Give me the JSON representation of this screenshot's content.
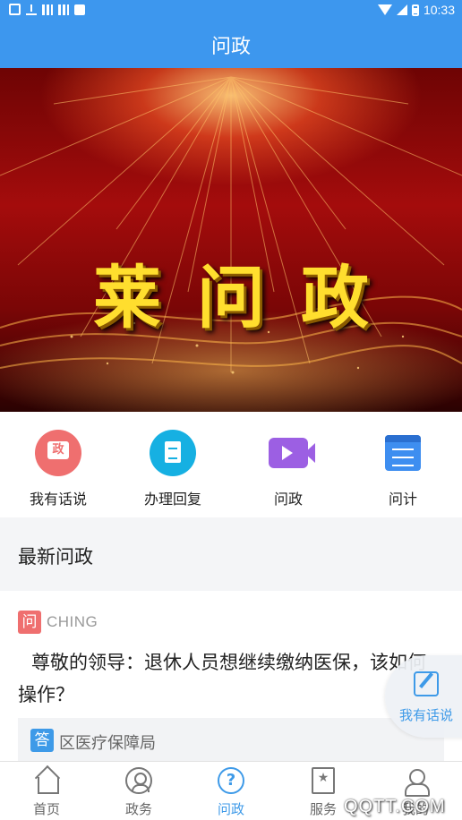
{
  "status_bar": {
    "time": "10:33"
  },
  "app_bar": {
    "title": "问政"
  },
  "banner": {
    "title": "莱问政"
  },
  "quick_menu": [
    {
      "label": "我有话说",
      "icon": "speech-bubble-icon"
    },
    {
      "label": "办理回复",
      "icon": "document-icon"
    },
    {
      "label": "问政",
      "icon": "video-camera-icon"
    },
    {
      "label": "问计",
      "icon": "notes-icon"
    }
  ],
  "section": {
    "title": "最新问政"
  },
  "post": {
    "tag": "问",
    "author": "CHING",
    "content": "尊敬的领导：退休人员想继续缴纳医保，该如何操作？",
    "answer_tag": "答",
    "answer_dept": "区医疗保障局"
  },
  "float_button": {
    "label": "我有话说",
    "icon": "edit-icon"
  },
  "bottom_nav": [
    {
      "label": "首页",
      "icon": "home-icon",
      "active": false
    },
    {
      "label": "政务",
      "icon": "person-circle-icon",
      "active": false
    },
    {
      "label": "问政",
      "icon": "question-bubble-icon",
      "active": true
    },
    {
      "label": "服务",
      "icon": "star-bookmark-icon",
      "active": false
    },
    {
      "label": "我的",
      "icon": "user-icon",
      "active": false
    }
  ],
  "watermark": "QQTT.COM",
  "colors": {
    "primary": "#3d97ee",
    "accent_red": "#ef6f6f",
    "accent_blue": "#3e9ae8"
  }
}
